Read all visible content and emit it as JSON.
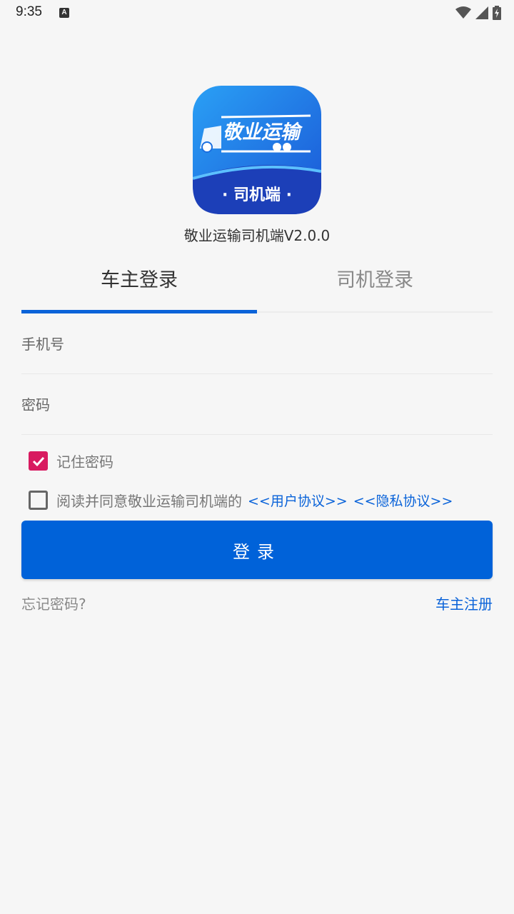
{
  "status_bar": {
    "time": "9:35",
    "notification_icon": "A"
  },
  "logo": {
    "title_text": "敬业运输",
    "subtitle_text": "· 司机端 ·"
  },
  "app_name": "敬业运输司机端V2.0.0",
  "tabs": [
    {
      "label": "车主登录",
      "selected": true
    },
    {
      "label": "司机登录",
      "selected": false
    }
  ],
  "form": {
    "phone_placeholder": "手机号",
    "password_placeholder": "密码",
    "remember": {
      "label": "记住密码",
      "checked": true
    },
    "agreement": {
      "label": "阅读并同意敬业运输司机端的",
      "user_agreement": "<<用户协议>>",
      "privacy_agreement": "<<隐私协议>>",
      "checked": false
    },
    "login_label": "登录"
  },
  "footer": {
    "forgot": "忘记密码?",
    "register": "车主注册"
  },
  "colors": {
    "accent": "#0062d9",
    "checkbox_checked": "#d81b60",
    "background": "#f6f6f6"
  }
}
